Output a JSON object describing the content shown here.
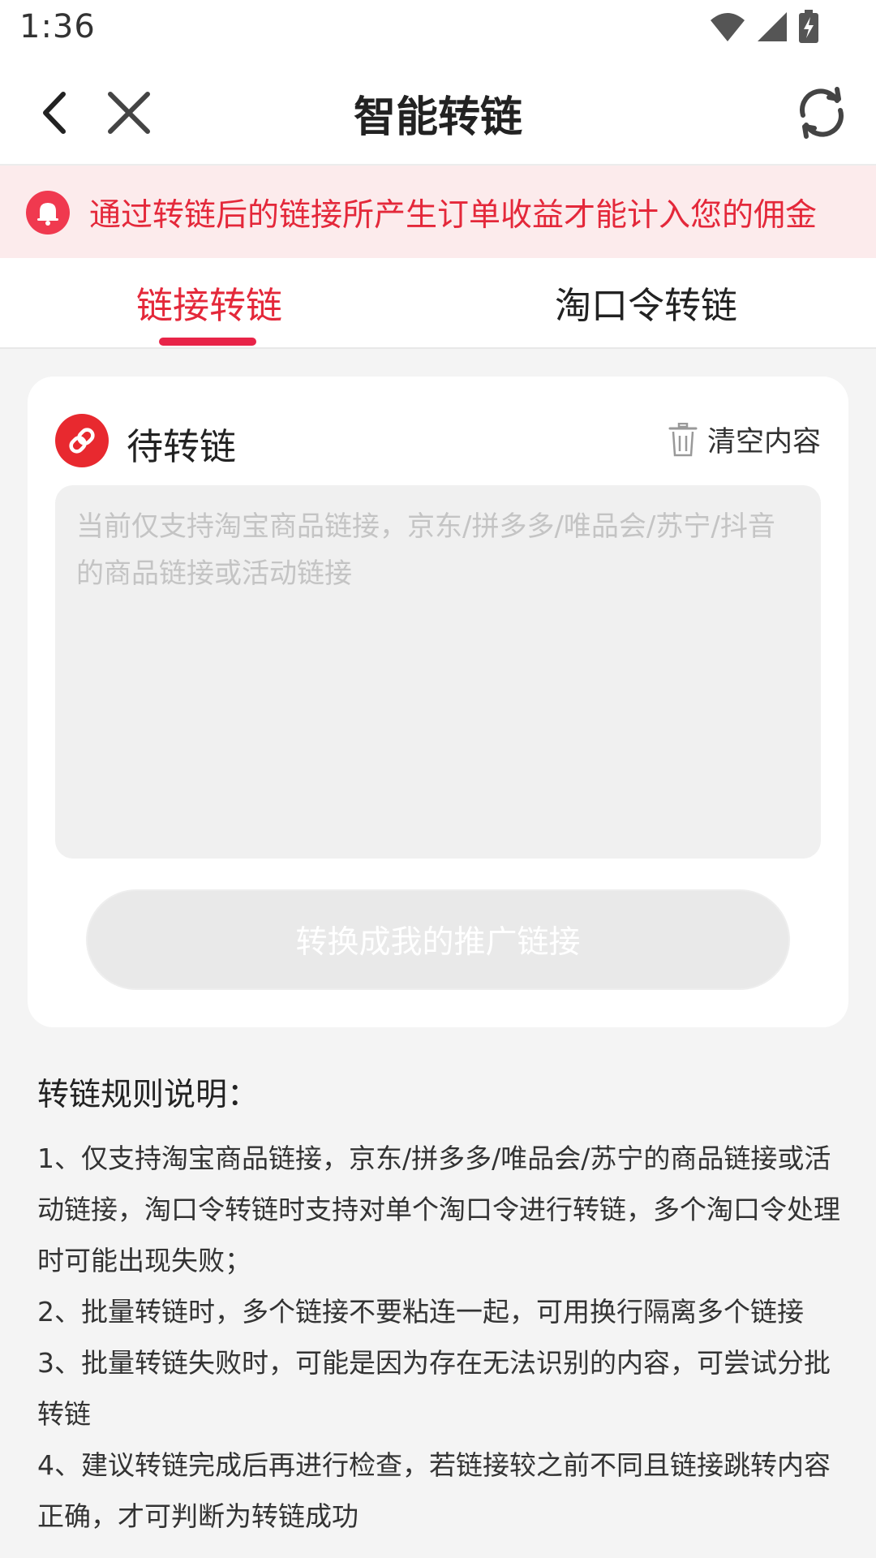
{
  "status": {
    "time": "1:36"
  },
  "header": {
    "title": "智能转链"
  },
  "notice": {
    "text": "通过转链后的链接所产生订单收益才能计入您的佣金"
  },
  "tabs": [
    {
      "label": "链接转链",
      "active": true
    },
    {
      "label": "淘口令转链",
      "active": false
    }
  ],
  "card": {
    "title": "待转链",
    "clear_label": "清空内容",
    "input_placeholder": "当前仅支持淘宝商品链接，京东/拼多多/唯品会/苏宁/抖音的商品链接或活动链接",
    "input_value": "",
    "convert_label": "转换成我的推广链接"
  },
  "rules": {
    "title": "转链规则说明：",
    "items": [
      "1、仅支持淘宝商品链接，京东/拼多多/唯品会/苏宁的商品链接或活动链接，淘口令转链时支持对单个淘口令进行转链，多个淘口令处理时可能出现失败；",
      "2、批量转链时，多个链接不要粘连一起，可用换行隔离多个链接",
      "3、批量转链失败时，可能是因为存在无法识别的内容，可尝试分批转链",
      "4、建议转链完成后再进行检查，若链接较之前不同且链接跳转内容正确，才可判断为转链成功"
    ]
  },
  "colors": {
    "accent": "#e4283a",
    "banner_bg": "#fcebec",
    "page_bg": "#f4f4f4",
    "button_disabled": "#e9e9e9"
  },
  "icons": [
    "wifi-icon",
    "signal-icon",
    "battery-charging-icon",
    "back-arrow-icon",
    "close-icon",
    "refresh-icon",
    "bell-icon",
    "link-icon",
    "trash-icon"
  ]
}
